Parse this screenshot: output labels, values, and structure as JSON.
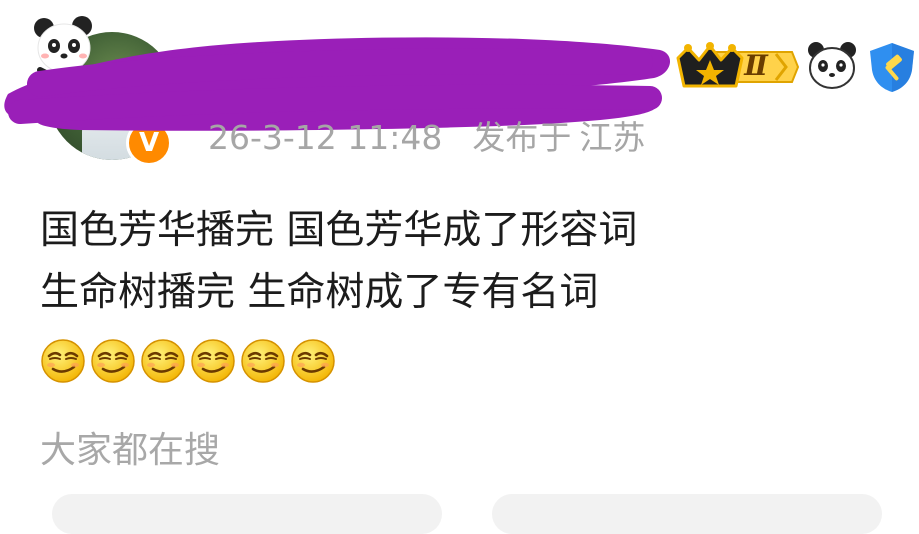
{
  "post": {
    "author": {
      "name_redacted": true,
      "level_badge": "Ⅱ",
      "badge_icons": [
        "crown-level-badge",
        "panda-face-icon",
        "shield-hammer-icon"
      ]
    },
    "meta": {
      "timestamp": "26-3-12 11:48",
      "location_prefix": "发布于",
      "location": "江苏"
    },
    "content": {
      "line1": "国色芳华播完 国色芳华成了形容词",
      "line2": "生命树播完 生命树成了专有名词",
      "emoji_name": "smirk-emoji",
      "emoji_count": 6
    },
    "trending": {
      "label": "大家都在搜"
    }
  },
  "colors": {
    "redaction": "#9a1fb8",
    "verified": "#ff8a00",
    "meta_text": "#a6a6a6",
    "body_text": "#1c1c1c",
    "shield": "#2f8ff0"
  }
}
